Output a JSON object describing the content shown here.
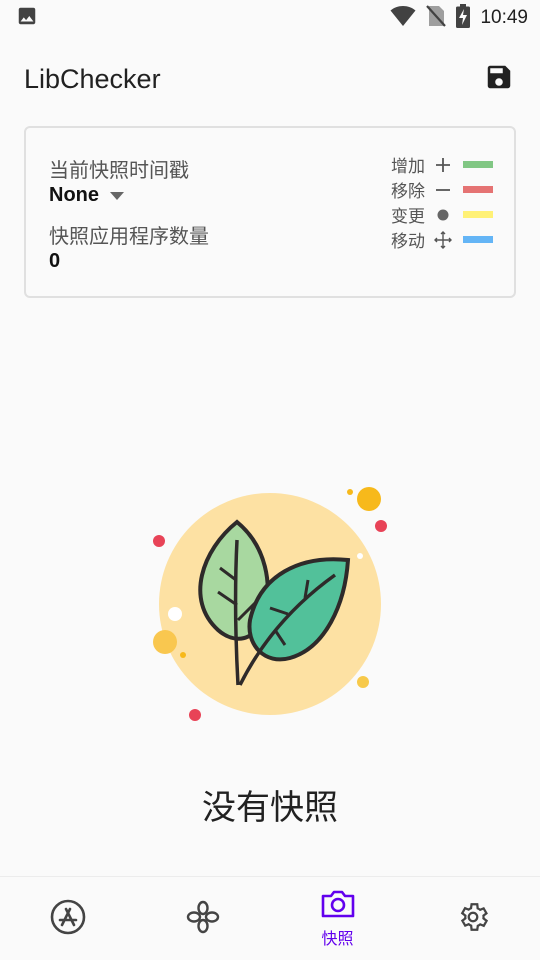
{
  "status_bar": {
    "time": "10:49",
    "icons": [
      "image-icon",
      "wifi-icon",
      "no-sim-icon",
      "battery-charging-icon"
    ]
  },
  "app_bar": {
    "title": "LibChecker",
    "action_icon": "save-icon"
  },
  "snapshot_card": {
    "timestamp_label": "当前快照时间戳",
    "timestamp_value": "None",
    "count_label": "快照应用程序数量",
    "count_value": "0",
    "legend": [
      {
        "label": "增加",
        "symbol": "plus",
        "color": "#81c784"
      },
      {
        "label": "移除",
        "symbol": "minus",
        "color": "#e57373"
      },
      {
        "label": "变更",
        "symbol": "dot",
        "color": "#fff176"
      },
      {
        "label": "移动",
        "symbol": "move",
        "color": "#64b5f6"
      }
    ]
  },
  "empty_state": {
    "text": "没有快照"
  },
  "bottom_nav": {
    "active_color": "#6200ee",
    "items": [
      {
        "icon": "app-store-icon",
        "label": "",
        "active": false
      },
      {
        "icon": "libraries-icon",
        "label": "",
        "active": false
      },
      {
        "icon": "camera-icon",
        "label": "快照",
        "active": true
      },
      {
        "icon": "settings-icon",
        "label": "",
        "active": false
      }
    ]
  },
  "colors": {
    "background": "#fafafa",
    "accent": "#6200ee",
    "card_border": "#e0e0e0"
  }
}
